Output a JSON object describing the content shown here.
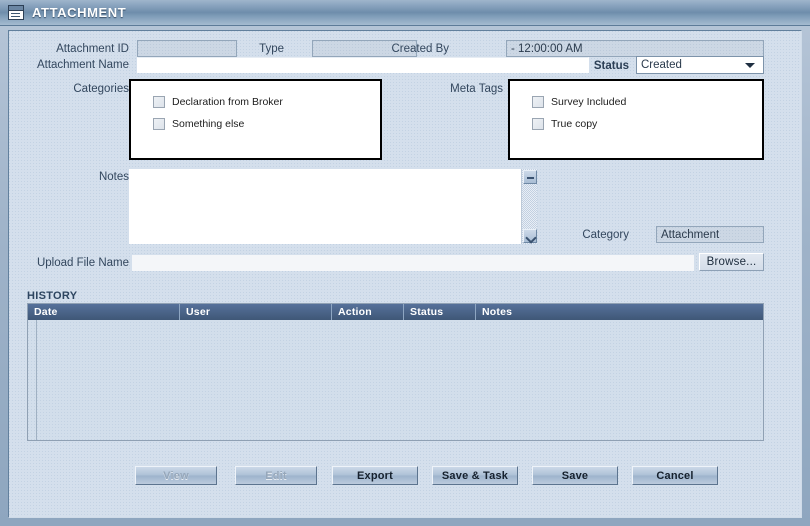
{
  "window": {
    "title": "ATTACHMENT",
    "icon": "form-window-icon"
  },
  "form": {
    "attachment_id": {
      "label": "Attachment ID",
      "value": ""
    },
    "type": {
      "label": "Type",
      "value": ""
    },
    "created_by": {
      "label": "Created By",
      "value": "-  12:00:00 AM"
    },
    "attachment_name": {
      "label": "Attachment Name",
      "value": ""
    },
    "status": {
      "label": "Status",
      "value": "Created"
    },
    "categories": {
      "label": "Categories",
      "items": [
        {
          "label": "Declaration from Broker",
          "checked": false
        },
        {
          "label": "Something else",
          "checked": false
        }
      ]
    },
    "meta_tags": {
      "label": "Meta Tags",
      "items": [
        {
          "label": "Survey Included",
          "checked": false
        },
        {
          "label": "True copy",
          "checked": false
        }
      ]
    },
    "notes": {
      "label": "Notes",
      "value": ""
    },
    "category": {
      "label": "Category",
      "value": "Attachment"
    },
    "upload_file_name": {
      "label": "Upload File Name",
      "value": ""
    },
    "browse_button": "Browse..."
  },
  "history": {
    "title": "HISTORY",
    "columns": [
      "Date",
      "User",
      "Action",
      "Status",
      "Notes"
    ],
    "rows": []
  },
  "footer": {
    "buttons": [
      {
        "label": "View",
        "enabled": false
      },
      {
        "label": "Edit",
        "enabled": false
      },
      {
        "label": "Export",
        "enabled": true
      },
      {
        "label": "Save & Task",
        "enabled": true
      },
      {
        "label": "Save",
        "enabled": true
      },
      {
        "label": "Cancel",
        "enabled": true
      }
    ]
  },
  "colors": {
    "titlebar": "#6e8dab",
    "body": "#d4dfec",
    "table_header": "#45608231",
    "accent": "#3f5777"
  }
}
